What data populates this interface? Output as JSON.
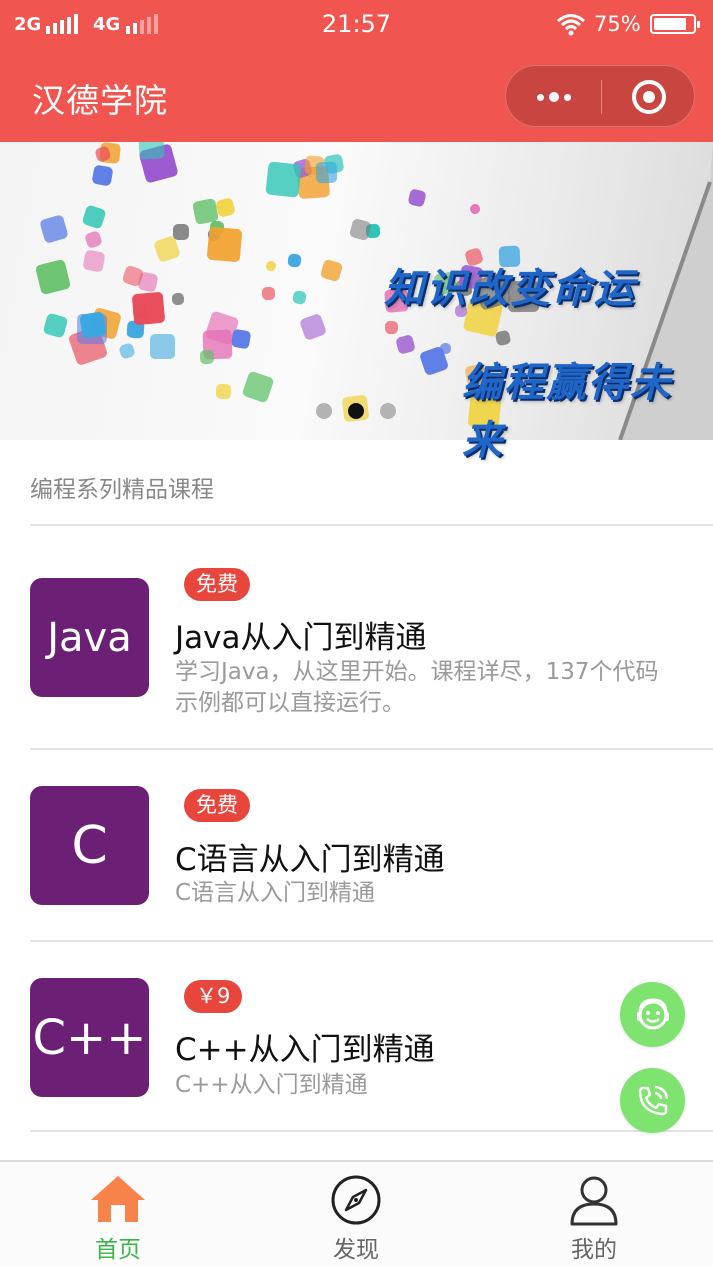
{
  "status_bar": {
    "signal1_label": "2G",
    "signal2_label": "4G",
    "time": "21:57",
    "battery": "75%"
  },
  "nav": {
    "title": "汉德学院",
    "more_icon": "more-dots-icon",
    "close_icon": "target-circle-icon"
  },
  "banner": {
    "slogan_line1": "知识改变命运",
    "slogan_line2": "编程赢得未来",
    "slide_count": 3,
    "active_slide": 2
  },
  "section": {
    "title": "编程系列精品课程"
  },
  "courses": [
    {
      "thumb_text": "Java",
      "badge": "免费",
      "name": "Java从入门到精通",
      "desc": "学习Java，从这里开始。课程详尽，137个代码示例都可以直接运行。"
    },
    {
      "thumb_text": "C",
      "badge": "免费",
      "name": "C语言从入门到精通",
      "desc": "C语言从入门到精通"
    },
    {
      "thumb_text": "C++",
      "badge": "￥9",
      "name": "C++从入门到精通",
      "desc": "C++从入门到精通"
    }
  ],
  "floating_buttons": {
    "service_icon": "customer-service-icon",
    "phone_icon": "phone-call-icon"
  },
  "tabs": [
    {
      "label": "首页",
      "icon": "home-icon",
      "active": true
    },
    {
      "label": "发现",
      "icon": "compass-icon",
      "active": false
    },
    {
      "label": "我的",
      "icon": "user-icon",
      "active": false
    }
  ],
  "colors": {
    "brand": "#f0564f",
    "badge": "#e8453c",
    "thumb": "#6b1f75",
    "tab_active": "#39b54a",
    "fab": "#7ee36f"
  }
}
